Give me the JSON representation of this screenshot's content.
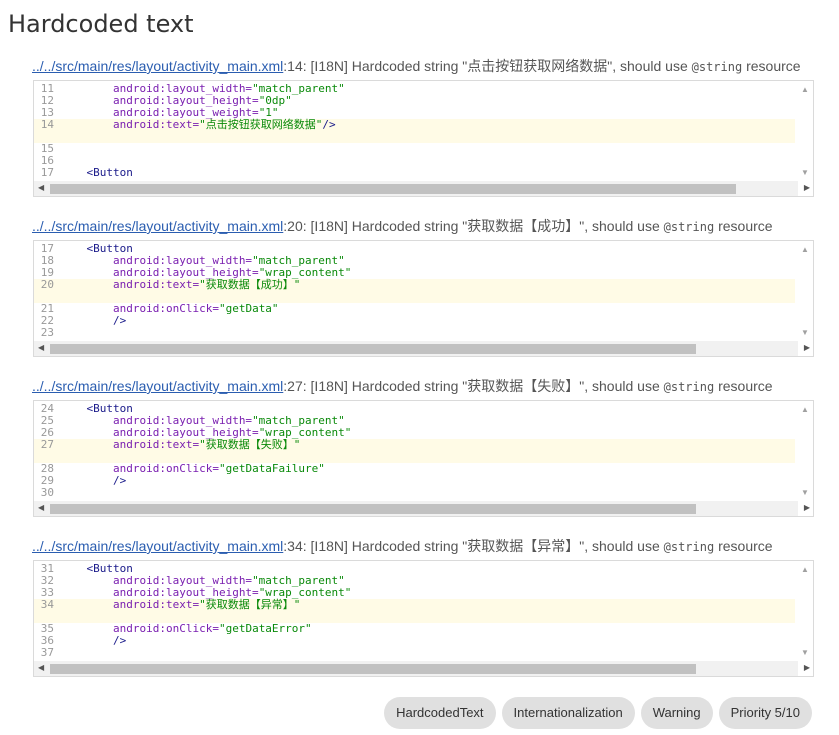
{
  "title": "Hardcoded text",
  "issues": [
    {
      "path": "../../src/main/res/layout/activity_main.xml",
      "line_suffix": ":14:",
      "msg": " [I18N] Hardcoded string \"点击按钮获取网络数据\", should use ",
      "code_word": "@string",
      "msg_end": " resource",
      "lines": [
        {
          "n": "11",
          "pre": "        ",
          "attr": "android:layout_width=",
          "val": "\"match_parent\"",
          "post": ""
        },
        {
          "n": "12",
          "pre": "        ",
          "attr": "android:layout_height=",
          "val": "\"0dp\"",
          "post": ""
        },
        {
          "n": "13",
          "pre": "        ",
          "attr": "android:layout_weight=",
          "val": "\"1\"",
          "post": ""
        },
        {
          "n": "14",
          "pre": "        ",
          "attr": "android:text=",
          "val": "\"点击按钮获取网络数据\"",
          "post": "/>",
          "hl": true
        },
        {
          "n": "",
          "gap": true,
          "hl": true
        },
        {
          "n": "15",
          "pre": "",
          "attr": "",
          "val": "",
          "post": ""
        },
        {
          "n": "16",
          "pre": "",
          "attr": "",
          "val": "",
          "post": ""
        },
        {
          "n": "17",
          "pre": "    ",
          "attr": "",
          "val": "",
          "post": "<Button"
        }
      ]
    },
    {
      "path": "../../src/main/res/layout/activity_main.xml",
      "line_suffix": ":20:",
      "msg": " [I18N] Hardcoded string \"获取数据【成功】\", should use ",
      "code_word": "@string",
      "msg_end": " resource",
      "lines": [
        {
          "n": "17",
          "pre": "    ",
          "attr": "",
          "val": "",
          "post": "<Button"
        },
        {
          "n": "18",
          "pre": "        ",
          "attr": "android:layout_width=",
          "val": "\"match_parent\"",
          "post": ""
        },
        {
          "n": "19",
          "pre": "        ",
          "attr": "android:layout_height=",
          "val": "\"wrap_content\"",
          "post": ""
        },
        {
          "n": "20",
          "pre": "        ",
          "attr": "android:text=",
          "val": "\"获取数据【成功】\"",
          "post": "",
          "hl": true
        },
        {
          "n": "",
          "gap": true,
          "hl": true
        },
        {
          "n": "21",
          "pre": "        ",
          "attr": "android:onClick=",
          "val": "\"getData\"",
          "post": ""
        },
        {
          "n": "22",
          "pre": "        ",
          "attr": "",
          "val": "",
          "post": "/>"
        },
        {
          "n": "23",
          "pre": "",
          "attr": "",
          "val": "",
          "post": ""
        }
      ]
    },
    {
      "path": "../../src/main/res/layout/activity_main.xml",
      "line_suffix": ":27:",
      "msg": " [I18N] Hardcoded string \"获取数据【失败】\", should use ",
      "code_word": "@string",
      "msg_end": " resource",
      "lines": [
        {
          "n": "24",
          "pre": "    ",
          "attr": "",
          "val": "",
          "post": "<Button"
        },
        {
          "n": "25",
          "pre": "        ",
          "attr": "android:layout_width=",
          "val": "\"match_parent\"",
          "post": ""
        },
        {
          "n": "26",
          "pre": "        ",
          "attr": "android:layout_height=",
          "val": "\"wrap_content\"",
          "post": ""
        },
        {
          "n": "27",
          "pre": "        ",
          "attr": "android:text=",
          "val": "\"获取数据【失败】\"",
          "post": "",
          "hl": true
        },
        {
          "n": "",
          "gap": true,
          "hl": true
        },
        {
          "n": "28",
          "pre": "        ",
          "attr": "android:onClick=",
          "val": "\"getDataFailure\"",
          "post": ""
        },
        {
          "n": "29",
          "pre": "        ",
          "attr": "",
          "val": "",
          "post": "/>"
        },
        {
          "n": "30",
          "pre": "",
          "attr": "",
          "val": "",
          "post": ""
        }
      ]
    },
    {
      "path": "../../src/main/res/layout/activity_main.xml",
      "line_suffix": ":34:",
      "msg": " [I18N] Hardcoded string \"获取数据【异常】\", should use ",
      "code_word": "@string",
      "msg_end": " resource",
      "lines": [
        {
          "n": "31",
          "pre": "    ",
          "attr": "",
          "val": "",
          "post": "<Button"
        },
        {
          "n": "32",
          "pre": "        ",
          "attr": "android:layout_width=",
          "val": "\"match_parent\"",
          "post": ""
        },
        {
          "n": "33",
          "pre": "        ",
          "attr": "android:layout_height=",
          "val": "\"wrap_content\"",
          "post": ""
        },
        {
          "n": "34",
          "pre": "        ",
          "attr": "android:text=",
          "val": "\"获取数据【异常】\"",
          "post": "",
          "hl": true
        },
        {
          "n": "",
          "gap": true,
          "hl": true
        },
        {
          "n": "35",
          "pre": "        ",
          "attr": "android:onClick=",
          "val": "\"getDataError\"",
          "post": ""
        },
        {
          "n": "36",
          "pre": "        ",
          "attr": "",
          "val": "",
          "post": "/>"
        },
        {
          "n": "37",
          "pre": "",
          "attr": "",
          "val": "",
          "post": ""
        }
      ]
    }
  ],
  "chips": [
    "HardcodedText",
    "Internationalization",
    "Warning",
    "Priority 5/10"
  ],
  "icons": {
    "up": "scroll-up-arrow-icon",
    "down": "scroll-down-arrow-icon",
    "left": "scroll-left-arrow-icon",
    "right": "scroll-right-arrow-icon"
  }
}
